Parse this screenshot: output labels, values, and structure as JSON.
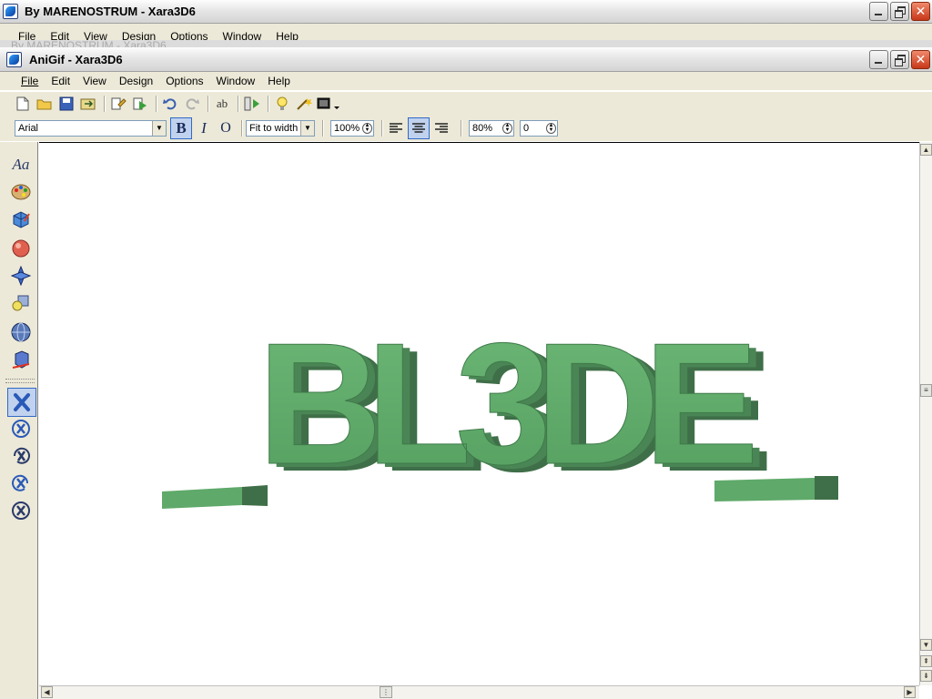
{
  "back_window": {
    "title": "By MARENOSTRUM - Xara3D6",
    "menu": [
      "File",
      "Edit",
      "View",
      "Design",
      "Options",
      "Window",
      "Help"
    ]
  },
  "hidden_window": {
    "title": "By MARENOSTRUM - Xara3D6"
  },
  "window": {
    "title": "AniGif - Xara3D6",
    "menu": [
      "File",
      "Edit",
      "View",
      "Design",
      "Options",
      "Window",
      "Help"
    ]
  },
  "toolbar2": {
    "font": "Arial",
    "bold_label": "B",
    "italic_label": "I",
    "outline_label": "O",
    "fit_mode": "Fit to width",
    "zoom": "100%",
    "line_spacing": "80%",
    "letter_spacing": "0"
  },
  "tools": {
    "text_tool_label": "Aa"
  },
  "artwork": {
    "text": "_BL3DE_",
    "face_color": "#5fa96a",
    "side_color": "#3f6f48"
  }
}
